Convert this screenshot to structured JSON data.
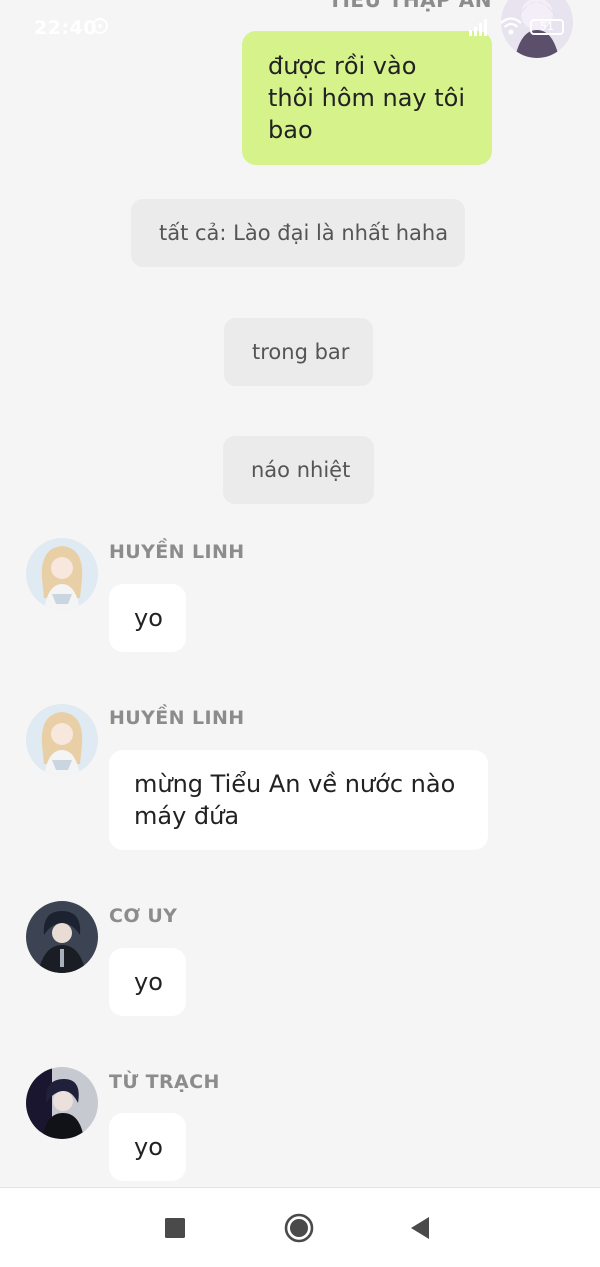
{
  "status_bar": {
    "time": "22:40",
    "battery": "51"
  },
  "header": {
    "sender_name": "TIỂU THẬP AN"
  },
  "messages": [
    {
      "type": "self",
      "text": "được rồi vào thôi hôm nay tôi bao"
    },
    {
      "type": "system",
      "text": "tất cả: Lào đại là nhất haha"
    },
    {
      "type": "system",
      "text": "trong bar"
    },
    {
      "type": "system",
      "text": "náo nhiệt"
    },
    {
      "type": "other",
      "sender": "HUYỀN LINH",
      "text": "yo"
    },
    {
      "type": "other",
      "sender": "HUYỀN LINH",
      "text": "mừng Tiểu An về nước nào máy đứa"
    },
    {
      "type": "other",
      "sender": "CƠ UY",
      "text": "yo"
    },
    {
      "type": "other",
      "sender": "TỪ TRẠCH",
      "text": "yo"
    }
  ],
  "nav": {
    "recents_icon": "square-icon",
    "home_icon": "circle-icon",
    "back_icon": "triangle-back-icon"
  },
  "colors": {
    "self_bubble": "#d6f28a",
    "other_bubble": "#ffffff",
    "system_bubble": "#ebebeb",
    "background": "#f5f5f5",
    "sender_name": "#8c8c8c"
  }
}
